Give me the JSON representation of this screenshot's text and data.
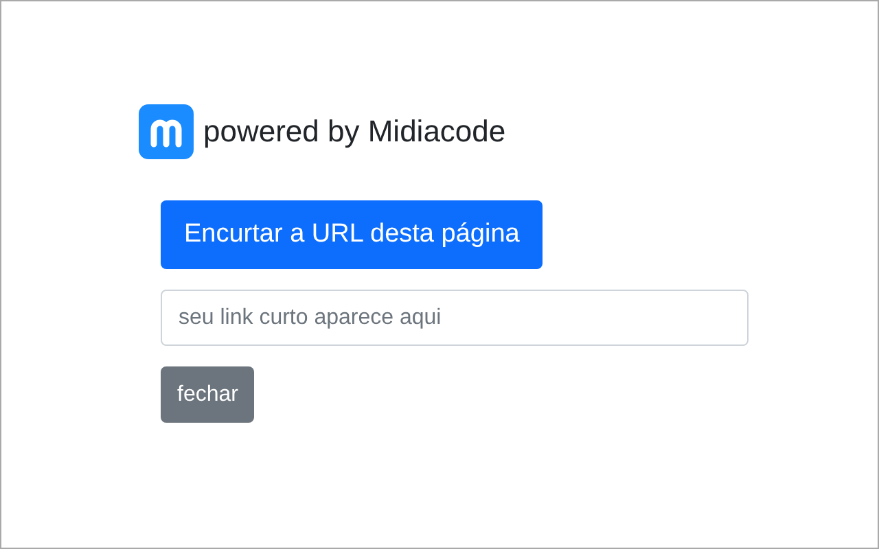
{
  "brand": {
    "text": "powered by Midiacode"
  },
  "shorten_button": {
    "label": "Encurtar a URL desta página"
  },
  "short_link_field": {
    "placeholder": "seu link curto aparece aqui"
  },
  "close_button": {
    "label": "fechar"
  }
}
